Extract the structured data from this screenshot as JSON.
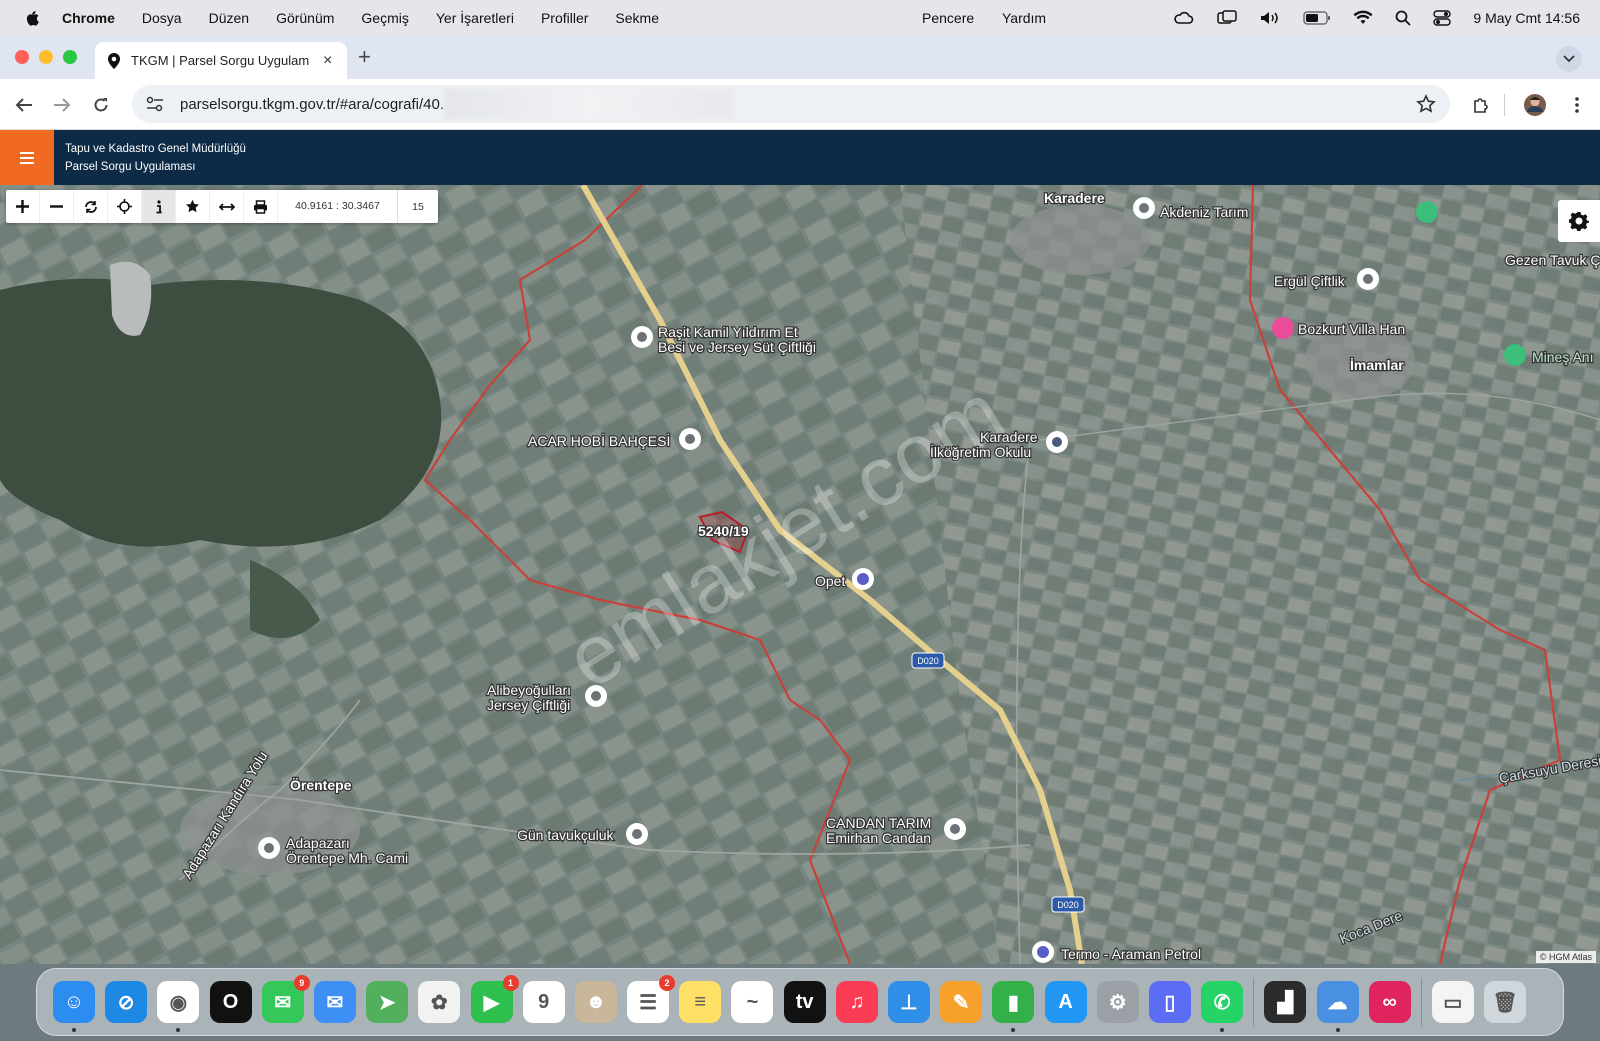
{
  "menubar": {
    "app": "Chrome",
    "items": [
      "Dosya",
      "Düzen",
      "Görünüm",
      "Geçmiş",
      "Yer İşaretleri",
      "Profiller",
      "Sekme"
    ],
    "right_items": [
      "Pencere",
      "Yardım"
    ],
    "clock": "9 May Cmt  14:56",
    "status_icons": [
      "creative-cloud-icon",
      "screen-mirroring-icon",
      "volume-icon",
      "battery-icon",
      "wifi-icon",
      "search-icon",
      "control-center-icon"
    ]
  },
  "tab": {
    "title": "TKGM | Parsel Sorgu Uygulam",
    "close": "×",
    "new_tab": "+"
  },
  "address": {
    "url": "parselsorgu.tkgm.gov.tr/#ara/cografi/40."
  },
  "app_header": {
    "org": "Tapu ve Kadastro Genel Müdürlüğü",
    "app": "Parsel Sorgu Uygulaması"
  },
  "map_toolbar": {
    "buttons": [
      "zoom-in",
      "zoom-out",
      "refresh",
      "locate",
      "info",
      "favorite",
      "measure",
      "print"
    ],
    "coordinates": "40.9161 : 30.3467",
    "zoom": "15"
  },
  "map": {
    "parcel_label": "5240/19",
    "watermark": "emlakjet.com",
    "attribution": "© HGM Atlas",
    "road_shields": [
      "D020",
      "D020"
    ],
    "places": [
      {
        "name": "Karadere"
      },
      {
        "name": "Akdeniz Tarım"
      },
      {
        "name": "Gezen Tavuk Ç"
      },
      {
        "name": "Ergül Çiftlik"
      },
      {
        "name": "Bozkurt Villa Han"
      },
      {
        "name": "İmamlar"
      },
      {
        "name": "Mineş Anı"
      },
      {
        "name": "Raşit Kamil Yıldırım Et"
      },
      {
        "name": "Besi ve Jersey Süt Çiftliği"
      },
      {
        "name": "ACAR HOBİ BAHÇESİ"
      },
      {
        "name": "Karadere"
      },
      {
        "name": "İlköğretim Okulu"
      },
      {
        "name": "Opet"
      },
      {
        "name": "Alibeyoğulları"
      },
      {
        "name": "Jersey Çiftliği"
      },
      {
        "name": "Örentepe"
      },
      {
        "name": "Adapazarı Kandıra Yolu"
      },
      {
        "name": "Adapazarı"
      },
      {
        "name": "Örentepe Mh. Cami"
      },
      {
        "name": "Gün tavukçuluk"
      },
      {
        "name": "CANDAN TARIM"
      },
      {
        "name": "Emirhan Candan"
      },
      {
        "name": "Termo - Araman Petrol"
      },
      {
        "name": "Çarksuyu Deresi"
      },
      {
        "name": "Koca Dere"
      }
    ]
  },
  "dock": {
    "apps": [
      {
        "name": "Finder",
        "color": "#2d8cf0",
        "glyph": "☺",
        "running": true
      },
      {
        "name": "Safari",
        "color": "#1e88e5",
        "glyph": "⊘",
        "running": false
      },
      {
        "name": "Chrome",
        "color": "#ffffff",
        "glyph": "◉",
        "running": true
      },
      {
        "name": "Opera",
        "color": "#111111",
        "glyph": "O",
        "running": false
      },
      {
        "name": "Messages",
        "color": "#34c759",
        "glyph": "✉",
        "badge": "9",
        "running": false
      },
      {
        "name": "Mail",
        "color": "#3d8ef5",
        "glyph": "✉",
        "running": false
      },
      {
        "name": "Maps",
        "color": "#52b05c",
        "glyph": "➤",
        "running": false
      },
      {
        "name": "Photos",
        "color": "#f2f2f2",
        "glyph": "✿",
        "running": false
      },
      {
        "name": "FaceTime",
        "color": "#2fbf4e",
        "glyph": "▶",
        "badge": "1",
        "running": false
      },
      {
        "name": "Calendar",
        "color": "#ffffff",
        "glyph": "9",
        "running": false
      },
      {
        "name": "Contacts",
        "color": "#c8b79a",
        "glyph": "☻",
        "running": false
      },
      {
        "name": "Reminders",
        "color": "#ffffff",
        "glyph": "☰",
        "badge": "2",
        "running": false
      },
      {
        "name": "Notes",
        "color": "#ffe066",
        "glyph": "≡",
        "running": false
      },
      {
        "name": "Freeform",
        "color": "#ffffff",
        "glyph": "~",
        "running": false
      },
      {
        "name": "Apple TV",
        "color": "#111111",
        "glyph": "tv",
        "running": false
      },
      {
        "name": "Music",
        "color": "#fa3d55",
        "glyph": "♫",
        "running": false
      },
      {
        "name": "Keynote",
        "color": "#2f8ee8",
        "glyph": "⊥",
        "running": false
      },
      {
        "name": "Pages",
        "color": "#f7a12c",
        "glyph": "✎",
        "running": false
      },
      {
        "name": "Numbers",
        "color": "#34b04a",
        "glyph": "▮",
        "running": true
      },
      {
        "name": "App Store",
        "color": "#2196f3",
        "glyph": "A",
        "running": false
      },
      {
        "name": "System Settings",
        "color": "#9aa0a6",
        "glyph": "⚙",
        "running": false
      },
      {
        "name": "iPhone Mirroring",
        "color": "#5b6cf5",
        "glyph": "▯",
        "running": false
      },
      {
        "name": "WhatsApp",
        "color": "#25d366",
        "glyph": "✆",
        "running": true
      },
      {
        "name": "Activity Monitor",
        "color": "#2b2b2b",
        "glyph": "▟",
        "running": false
      },
      {
        "name": "Migration",
        "color": "#4a90e2",
        "glyph": "☁",
        "running": true
      },
      {
        "name": "Creative Cloud",
        "color": "#e0245e",
        "glyph": "∞",
        "running": false
      },
      {
        "name": "Preview",
        "color": "#f4f4f4",
        "glyph": "▭",
        "running": false
      },
      {
        "name": "Trash",
        "color": "#cfd6dc",
        "glyph": "🗑",
        "running": false
      }
    ]
  }
}
